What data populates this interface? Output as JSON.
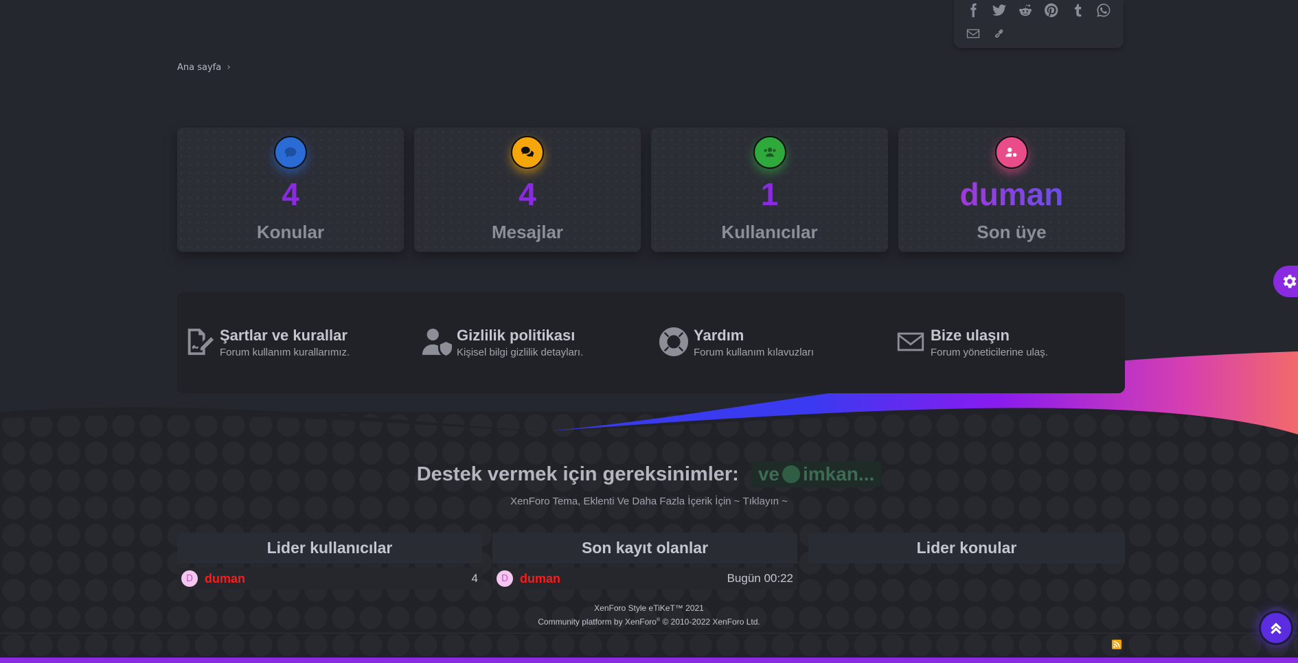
{
  "breadcrumb": {
    "home": "Ana sayfa"
  },
  "stats": [
    {
      "value": "4",
      "label": "Konular",
      "color": "#2a6bd6"
    },
    {
      "value": "4",
      "label": "Mesajlar",
      "color": "#f5a60a"
    },
    {
      "value": "1",
      "label": "Kullanıcılar",
      "color": "#2fa83c"
    },
    {
      "value": "duman",
      "label": "Son üye",
      "color": "#e84d8a"
    }
  ],
  "links": [
    {
      "title": "Şartlar ve kurallar",
      "desc": "Forum kullanım kurallarımız."
    },
    {
      "title": "Gizlilik politikası",
      "desc": "Kişisel bilgi gizlilik detayları."
    },
    {
      "title": "Yardım",
      "desc": "Forum kullanım kılavuzları"
    },
    {
      "title": "Bize ulaşın",
      "desc": "Forum yöneticilerine ulaş."
    }
  ],
  "support": {
    "title": "Destek vermek için gereksinimler:",
    "box_left": "ve",
    "box_right": "imkan..."
  },
  "promo": {
    "text": "XenForo Tema, Eklenti Ve Daha Fazla İçerik İçin",
    "link": "~ Tıklayın ~"
  },
  "columns": [
    {
      "title": "Lider kullanıcılar",
      "row_user": "duman",
      "row_value": "4",
      "avatar": "D"
    },
    {
      "title": "Son kayıt olanlar",
      "row_user": "duman",
      "row_value": "Bugün 00:22",
      "avatar": "D"
    },
    {
      "title": "Lider konular"
    }
  ],
  "footer": {
    "style": "XenForo Style eTiKeT™ 2021",
    "platform_pre": "Community platform by XenForo",
    "platform_sup": "®",
    "platform_post": " © 2010-2022 XenForo Ltd."
  },
  "colors": {
    "accent": "#8a2be2",
    "username": "#ff1a1a",
    "wave_start": "#3a3af0",
    "wave_end": "#f26a6a"
  }
}
